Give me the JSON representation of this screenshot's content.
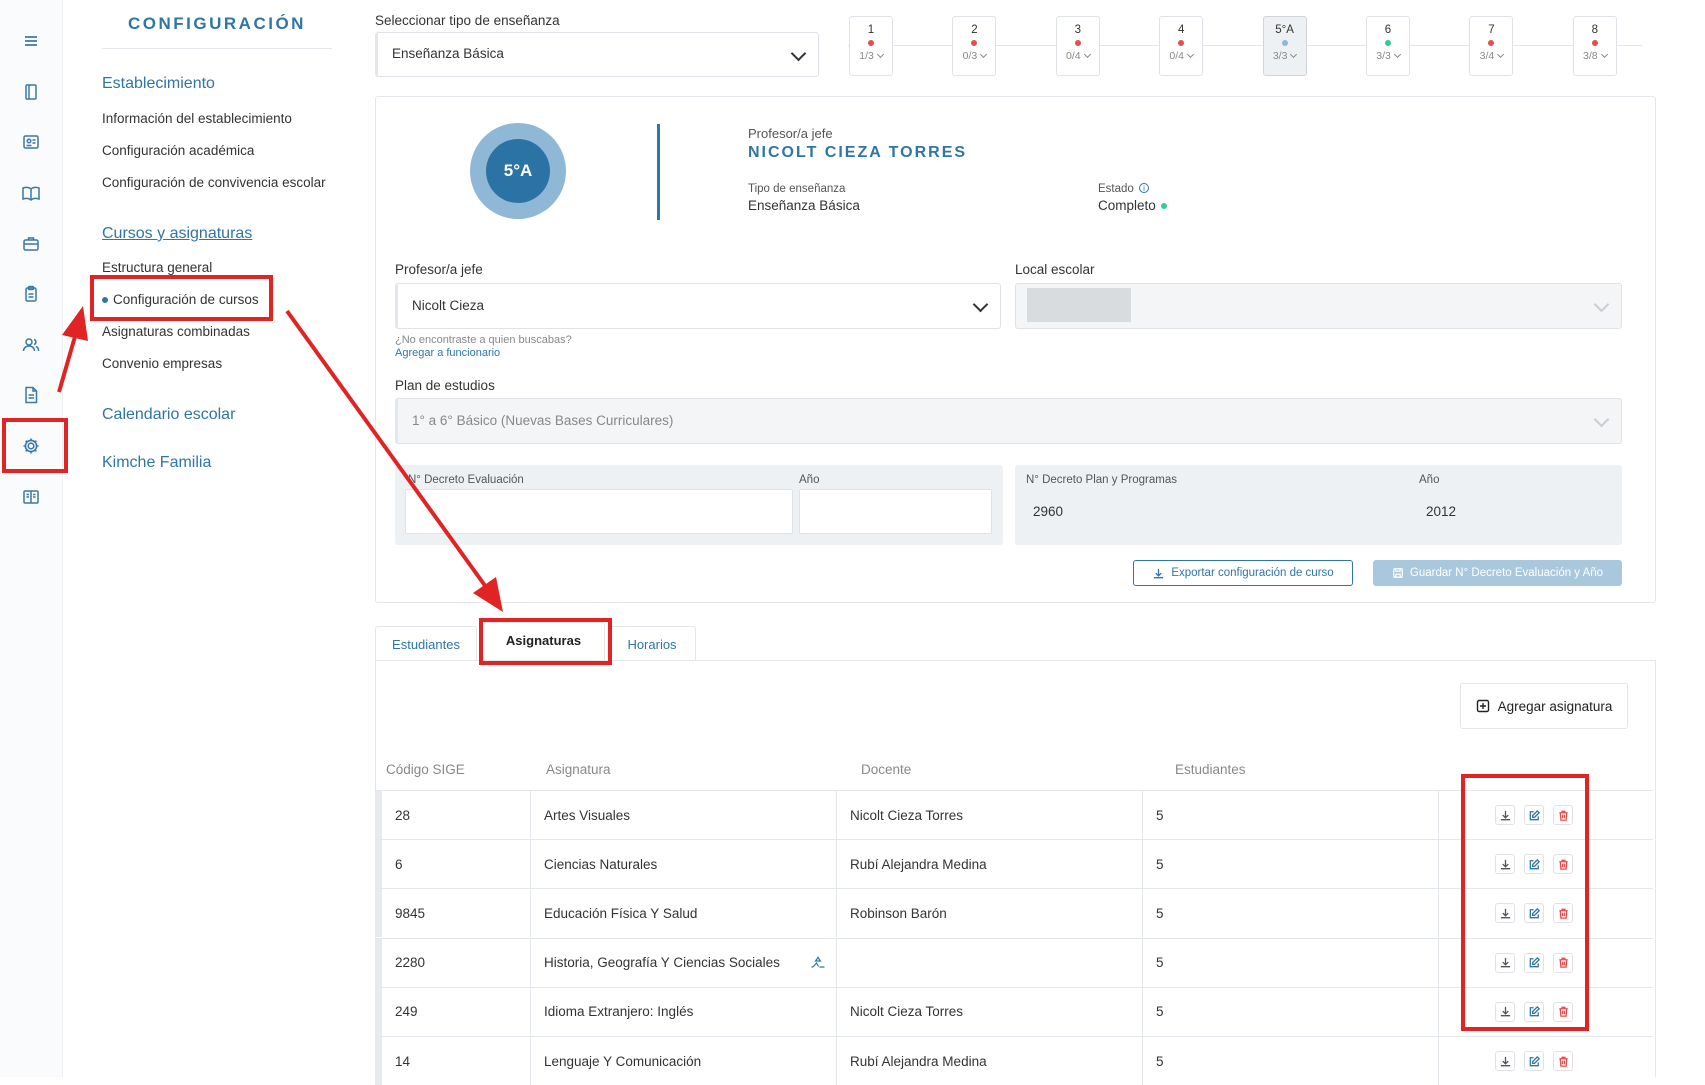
{
  "sidebar": {
    "title": "CONFIGURACIÓN",
    "sections": [
      {
        "heading": "Establecimiento",
        "items": [
          "Información del establecimiento",
          "Configuración académica",
          "Configuración de convivencia escolar"
        ]
      },
      {
        "heading": "Cursos y asignaturas",
        "items": [
          "Estructura general",
          "Configuración de cursos",
          "Asignaturas combinadas",
          "Convenio empresas"
        ]
      },
      {
        "heading": "Calendario escolar",
        "items": []
      },
      {
        "heading": "Kimche Familia",
        "items": []
      }
    ]
  },
  "rail_icons": [
    "menu-icon",
    "book-icon",
    "id-card-icon",
    "open-book-icon",
    "briefcase-icon",
    "clipboard-icon",
    "users-icon",
    "document-icon",
    "gear-icon",
    "reader-icon"
  ],
  "teaching_type": {
    "label": "Seleccionar tipo de enseñanza",
    "value": "Enseñanza Básica"
  },
  "grades": [
    {
      "label": "1",
      "count": "1/3",
      "status": "red"
    },
    {
      "label": "2",
      "count": "0/3",
      "status": "red"
    },
    {
      "label": "3",
      "count": "0/4",
      "status": "red"
    },
    {
      "label": "4",
      "count": "0/4",
      "status": "red"
    },
    {
      "label": "5°A",
      "count": "3/3",
      "status": "blue"
    },
    {
      "label": "6",
      "count": "3/3",
      "status": "green"
    },
    {
      "label": "7",
      "count": "3/4",
      "status": "red"
    },
    {
      "label": "8",
      "count": "3/8",
      "status": "red"
    }
  ],
  "colors": {
    "primary": "#2f76a6",
    "red": "#e74c4c",
    "green": "#2ecc9a",
    "blue_dot": "#8fb8d6",
    "annotation": "#e02424"
  },
  "course": {
    "badge": "5°A",
    "head_teacher_label": "Profesor/a jefe",
    "head_teacher_name": "NICOLT CIEZA TORRES",
    "type_label": "Tipo de enseñanza",
    "type_value": "Enseñanza Básica",
    "status_label": "Estado",
    "status_value": "Completo"
  },
  "form": {
    "teacher_label": "Profesor/a jefe",
    "teacher_value": "Nicolt Cieza",
    "not_found": "¿No encontraste a quien buscabas?",
    "add_staff": "Agregar a funcionario",
    "local_label": "Local escolar",
    "plan_label": "Plan de estudios",
    "plan_value": "1° a 6° Básico (Nuevas Bases Curriculares)",
    "decree_eval_label": "N° Decreto Evaluación",
    "year_label": "Año",
    "decree_plan_label": "N° Decreto Plan y Programas",
    "decree_plan_value": "2960",
    "decree_plan_year": "2012",
    "export_btn": "Exportar configuración de curso",
    "save_btn": "Guardar N° Decreto Evaluación y Año"
  },
  "tabs": [
    "Estudiantes",
    "Asignaturas",
    "Horarios"
  ],
  "subjects": {
    "add_btn": "Agregar asignatura",
    "headers": [
      "Código SIGE",
      "Asignatura",
      "Docente",
      "Estudiantes"
    ],
    "rows": [
      {
        "code": "28",
        "name": "Artes Visuales",
        "teacher": "Nicolt Cieza Torres",
        "students": "5"
      },
      {
        "code": "6",
        "name": "Ciencias Naturales",
        "teacher": "Rubí Alejandra Medina",
        "students": "5"
      },
      {
        "code": "9845",
        "name": "Educación Física Y Salud",
        "teacher": "Robinson Barón",
        "students": "5"
      },
      {
        "code": "2280",
        "name": "Historia, Geografía Y Ciencias Sociales",
        "teacher": "",
        "students": "5"
      },
      {
        "code": "249",
        "name": "Idioma Extranjero: Inglés",
        "teacher": "Nicolt Cieza Torres",
        "students": "5"
      },
      {
        "code": "14",
        "name": "Lenguaje Y Comunicación",
        "teacher": "Rubí Alejandra Medina",
        "students": "5"
      }
    ]
  }
}
